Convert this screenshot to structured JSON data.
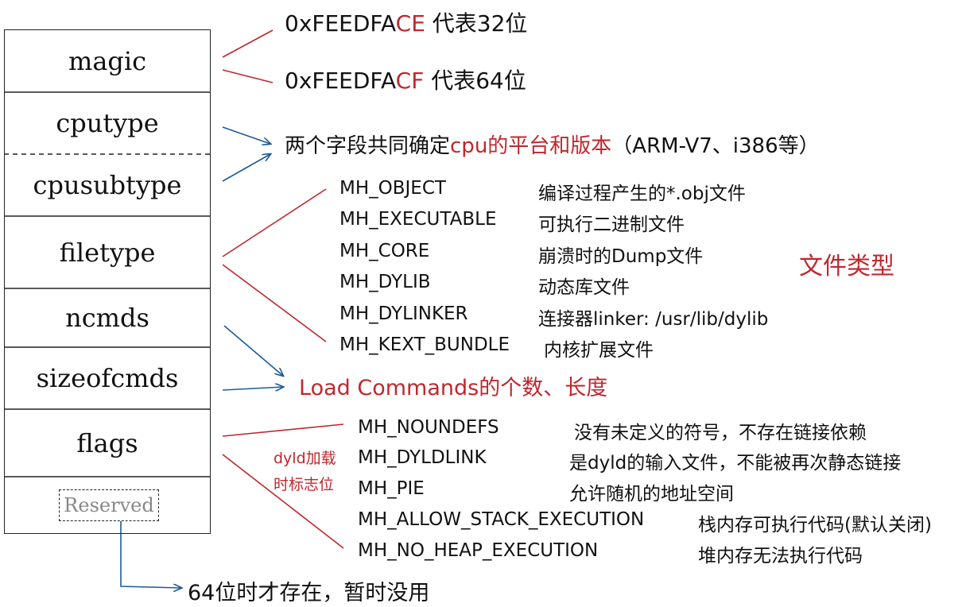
{
  "struct": {
    "fields": [
      "magic",
      "cputype",
      "cpusubtype",
      "filetype",
      "ncmds",
      "sizeofcmds",
      "flags"
    ],
    "reserved": "Reserved"
  },
  "magic": {
    "line32": {
      "prefix": "0xFEEDFA",
      "suffix": "CE",
      "rest": " 代表32位"
    },
    "line64": {
      "prefix": "0xFEEDFA",
      "suffix": "CF",
      "rest": " 代表64位"
    }
  },
  "cpu": {
    "pre": "两个字段共同确定",
    "red": "cpu的平台和版本",
    "post": "（ARM-V7、i386等）"
  },
  "filetypes": {
    "label": "文件类型",
    "items": [
      {
        "name": "MH_OBJECT",
        "desc": "编译过程产生的*.obj文件"
      },
      {
        "name": "MH_EXECUTABLE",
        "desc": "可执行二进制文件"
      },
      {
        "name": "MH_CORE",
        "desc": "崩溃时的Dump文件"
      },
      {
        "name": "MH_DYLIB",
        "desc": "动态库文件"
      },
      {
        "name": "MH_DYLINKER",
        "desc": "连接器linker: /usr/lib/dylib"
      },
      {
        "name": "MH_KEXT_BUNDLE",
        "desc": "内核扩展文件"
      }
    ]
  },
  "loadcmds": {
    "text": "Load Commands的个数、长度"
  },
  "flags": {
    "note_line1": "dyld加载",
    "note_line2": "时标志位",
    "items": [
      {
        "name": "MH_NOUNDEFS",
        "desc": "没有未定义的符号，不存在链接依赖"
      },
      {
        "name": "MH_DYLDLINK",
        "desc": "是dyld的输入文件，不能被再次静态链接"
      },
      {
        "name": "MH_PIE",
        "desc": "允许随机的地址空间"
      },
      {
        "name": "MH_ALLOW_STACK_EXECUTION",
        "desc": "栈内存可执行代码(默认关闭)"
      },
      {
        "name": "MH_NO_HEAP_EXECUTION",
        "desc": "堆内存无法执行代码"
      }
    ]
  },
  "reserved_note": "64位时才存在，暂时没用",
  "colors": {
    "red": "#c0272d",
    "blue": "#1f5a96",
    "dark": "#222222"
  }
}
